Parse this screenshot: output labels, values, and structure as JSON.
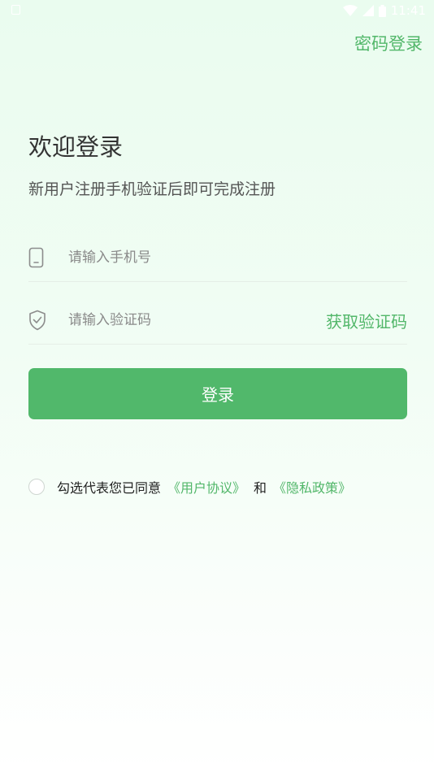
{
  "status_bar": {
    "time": "11:41"
  },
  "header": {
    "password_login_label": "密码登录"
  },
  "welcome": {
    "title": "欢迎登录",
    "subtitle": "新用户注册手机验证后即可完成注册"
  },
  "form": {
    "phone_placeholder": "请输入手机号",
    "phone_value": "",
    "code_placeholder": "请输入验证码",
    "code_value": "",
    "get_code_label": "获取验证码",
    "login_label": "登录"
  },
  "agreement": {
    "checked": false,
    "prefix": "勾选代表您已同意",
    "user_agreement": "《用户协议》",
    "and": "和",
    "privacy_policy": "《隐私政策》"
  },
  "icons": {
    "phone": "phone-icon",
    "shield": "shield-check-icon",
    "wifi": "wifi-icon",
    "signal": "signal-icon",
    "battery": "battery-icon",
    "notification": "notification-icon"
  },
  "colors": {
    "accent": "#52b76a",
    "button": "#51b86b",
    "background_top": "#eafcef",
    "text_primary": "#333333",
    "text_placeholder": "#8a8a8a"
  }
}
